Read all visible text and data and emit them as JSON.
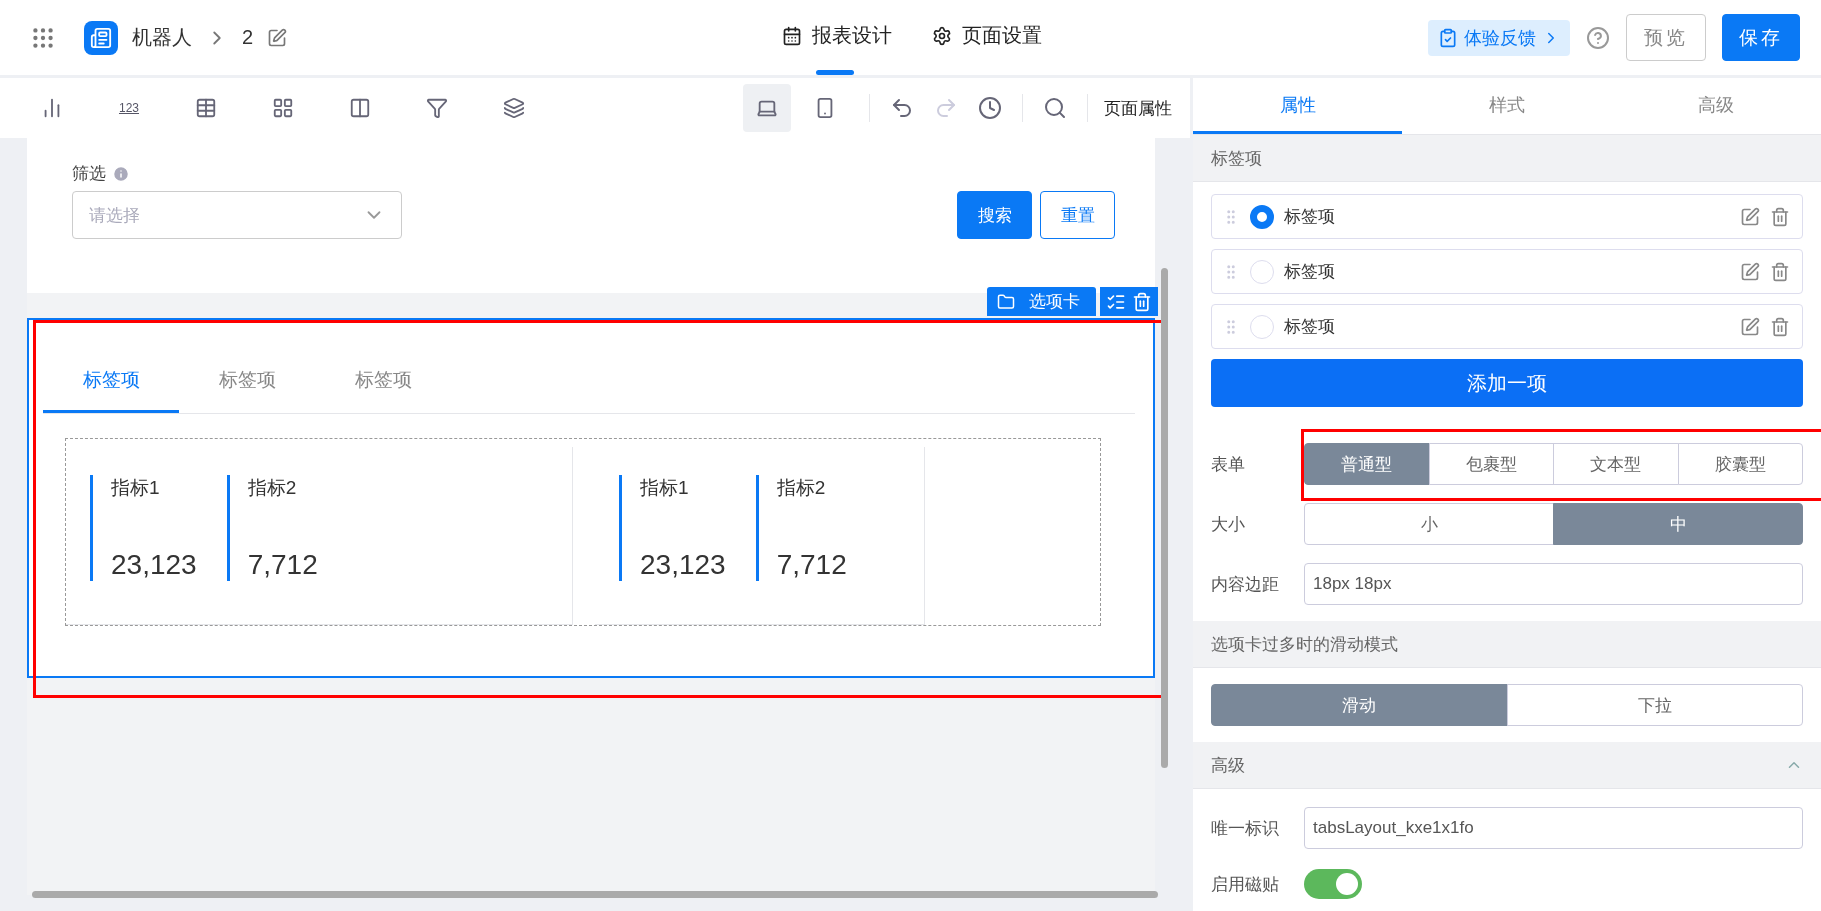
{
  "app_bar": {
    "app_name": "机器人",
    "page_name": "2",
    "tabs": [
      {
        "label": "报表设计",
        "kind": "design",
        "selected": true
      },
      {
        "label": "页面设置",
        "kind": "settings",
        "selected": false
      }
    ],
    "feedback": "体验反馈",
    "buttons": [
      {
        "label": "预览",
        "kind": "outline"
      },
      {
        "label": "保存",
        "kind": "primary"
      }
    ]
  },
  "toolbar": {
    "number_widget": "123",
    "devices": [
      {
        "kind": "desktop",
        "selected": true
      },
      {
        "kind": "mobile",
        "selected": false
      }
    ],
    "history": [
      {
        "kind": "undo",
        "disabled": false
      },
      {
        "kind": "redo",
        "disabled": true
      }
    ],
    "page_properties": "页面属性"
  },
  "canvas": {
    "filter": {
      "label": "筛选",
      "placeholder": "请选择",
      "buttons": [
        {
          "label": "搜索",
          "kind": "primary"
        },
        {
          "label": "重置",
          "kind": "outline"
        }
      ]
    },
    "tabs_component": {
      "badge": "选项卡",
      "selected": true,
      "tabs": [
        {
          "label": "标签项",
          "selected": true
        },
        {
          "label": "标签项",
          "selected": false
        },
        {
          "label": "标签项",
          "selected": false
        }
      ],
      "cards": [
        {
          "metrics": [
            {
              "label": "指标1",
              "value": "23,123"
            },
            {
              "label": "指标2",
              "value": "7,712"
            }
          ]
        },
        {
          "metrics": [
            {
              "label": "指标1",
              "value": "23,123"
            },
            {
              "label": "指标2",
              "value": "7,712"
            }
          ]
        }
      ]
    }
  },
  "panel": {
    "tabs": [
      {
        "label": "属性",
        "selected": true
      },
      {
        "label": "样式",
        "selected": false
      },
      {
        "label": "高级",
        "selected": false
      }
    ],
    "tab_items": {
      "title": "标签项",
      "items": [
        {
          "label": "标签项",
          "selected": true
        },
        {
          "label": "标签项",
          "selected": false
        },
        {
          "label": "标签项",
          "selected": false
        }
      ],
      "add_button": "添加一项"
    },
    "rows": [
      {
        "kind": "segmented",
        "label": "表单",
        "options": [
          {
            "label": "普通型",
            "selected": true
          },
          {
            "label": "包裹型",
            "selected": false
          },
          {
            "label": "文本型",
            "selected": false
          },
          {
            "label": "胶囊型",
            "selected": false
          }
        ]
      },
      {
        "kind": "segmented",
        "label": "大小",
        "options": [
          {
            "label": "小",
            "selected": false
          },
          {
            "label": "中",
            "selected": true
          }
        ]
      },
      {
        "kind": "input",
        "label": "内容边距",
        "value": "18px 18px"
      }
    ],
    "scroll_mode": {
      "title": "选项卡过多时的滑动模式",
      "options": [
        {
          "label": "滑动",
          "selected": true
        },
        {
          "label": "下拉",
          "selected": false
        }
      ]
    },
    "advanced": {
      "title": "高级",
      "expanded": true,
      "rows": [
        {
          "kind": "input",
          "label": "唯一标识",
          "value": "tabsLayout_kxe1x1fo"
        },
        {
          "kind": "toggle",
          "label": "启用磁贴",
          "on": true
        }
      ]
    }
  }
}
